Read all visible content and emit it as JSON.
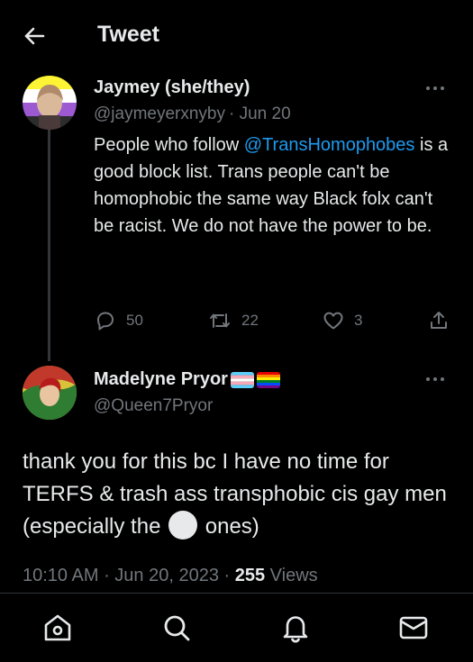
{
  "header": {
    "title": "Tweet",
    "back_icon": "arrow-left-icon"
  },
  "tweet": {
    "author_name": "Jaymey (she/they)",
    "author_handle": "@jaymeyerxnyby",
    "date": "· Jun 20",
    "text_before": "People who follow ",
    "mention": "@TransHomophobes",
    "text_after": " is a good block list. Trans people can't be homophobic the same way Black folx can't be racist. We do not have the power to be.",
    "replies": "50",
    "retweets": "22",
    "likes": "3",
    "avatar_flag_colors": [
      "#fcf434",
      "#ffffff",
      "#9c59d1",
      "#2c2c2c"
    ]
  },
  "reply": {
    "author_name": "Madelyne Pryor",
    "author_handle": "@Queen7Pryor",
    "text_before": "thank you for this bc I have no time for TERFS & trash ass transphobic cis gay men (especially the ",
    "emoji_icon": "white-circle-emoji",
    "text_after": " ones)",
    "time": "10:10 AM",
    "date": "Jun 20, 2023",
    "views_count": "255",
    "views_label": "Views"
  },
  "colors": {
    "background": "#000000",
    "text": "#e7e9ea",
    "secondary": "#71767b",
    "link": "#1d9bf0",
    "divider": "#2f3336"
  },
  "nav": [
    "home-icon",
    "search-icon",
    "notifications-icon",
    "messages-icon"
  ]
}
